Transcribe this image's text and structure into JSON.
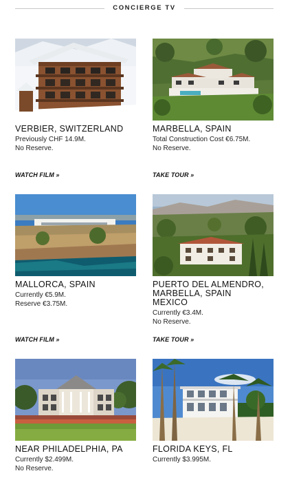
{
  "header": {
    "title": "CONCIERGE TV"
  },
  "listings": [
    {
      "location": "VERBIER, SWITZERLAND",
      "lines": [
        "Previously CHF 14.9M.",
        "No Reserve."
      ],
      "link": "WATCH FILM »",
      "image": "chalet-photo"
    },
    {
      "location": "MARBELLA, SPAIN",
      "lines": [
        "Total Construction Cost €6.75M.",
        "No Reserve."
      ],
      "link": "TAKE TOUR »",
      "image": "hillside-villa-photo"
    },
    {
      "location": "MALLORCA, SPAIN",
      "lines": [
        "Currently €5.9M.",
        "Reserve €3.75M."
      ],
      "link": "WATCH FILM »",
      "image": "cliffside-estate-photo"
    },
    {
      "location_lines": [
        "PUERTO DEL ALMENDRO,",
        "MARBELLA, SPAIN",
        "MEXICO"
      ],
      "lines": [
        "Currently €3.4M.",
        "No Reserve."
      ],
      "link": "TAKE TOUR »",
      "image": "mountain-villa-photo"
    },
    {
      "location": "NEAR PHILADELPHIA, PA",
      "lines": [
        "Currently $2.499M.",
        "No Reserve."
      ],
      "image": "mansion-photo"
    },
    {
      "location": "FLORIDA KEYS, FL",
      "lines": [
        "Currently $3.995M."
      ],
      "image": "beach-house-photo"
    }
  ]
}
